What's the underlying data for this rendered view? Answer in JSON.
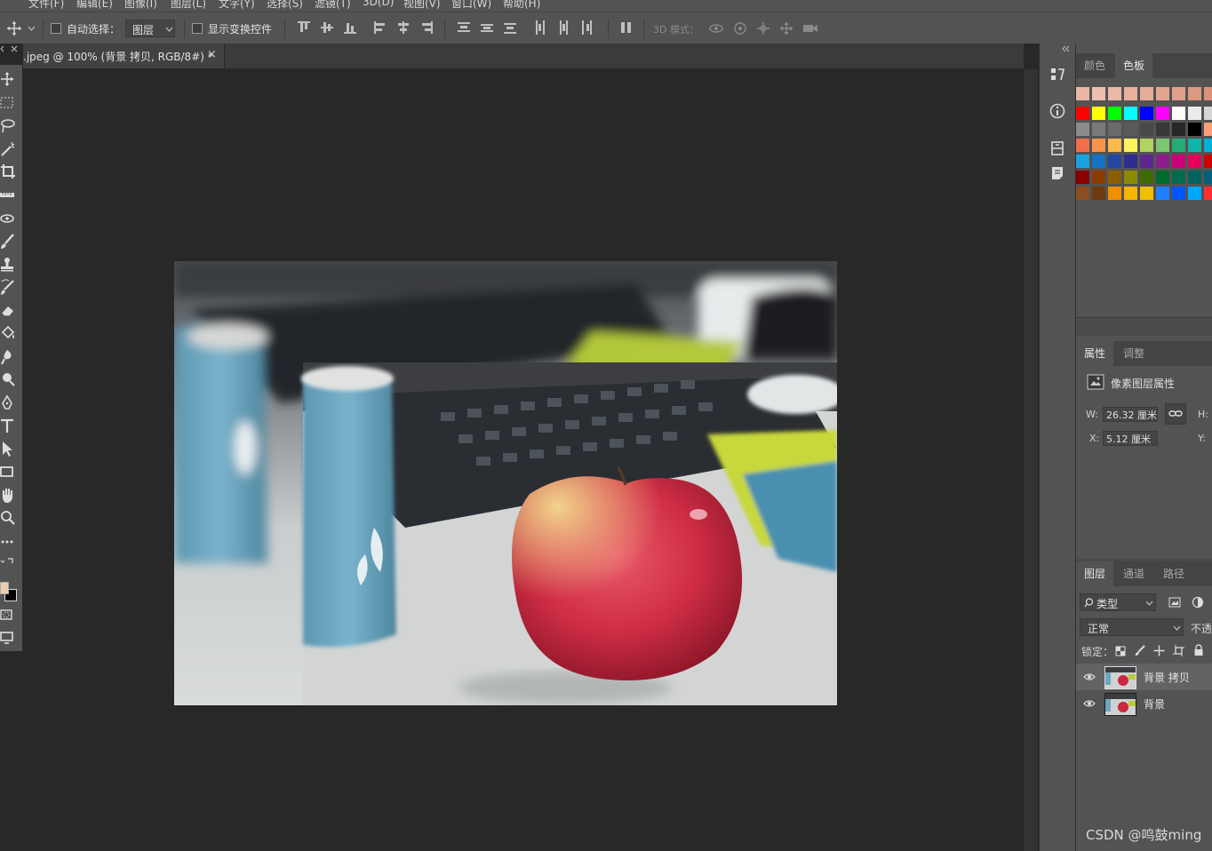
{
  "menubar": {
    "items": [
      "文件(F)",
      "编辑(E)",
      "图像(I)",
      "图层(L)",
      "文字(Y)",
      "选择(S)",
      "滤镜(T)",
      "3D(D)",
      "视图(V)",
      "窗口(W)",
      "帮助(H)"
    ]
  },
  "options": {
    "auto_select_label": "自动选择：",
    "auto_select_value": "图层",
    "show_transform_label": "显示变换控件",
    "mode_3d_label": "3D 模式："
  },
  "document": {
    "tab_title": ".jpeg @ 100% (背景 拷贝, RGB/8#) *",
    "close_glyph": "×"
  },
  "swatches_panel": {
    "tabs": [
      "颜色",
      "色板"
    ],
    "active_tab": "色板",
    "rows": [
      [
        "#e9b7a6",
        "#ecc0b1",
        "#eab9a8",
        "#e8b29f",
        "#e6ad98",
        "#e4a691",
        "#e0a08a",
        "#dd9882",
        "#da927c",
        "#d88c75"
      ],
      [
        "#ff0000",
        "#ffff00",
        "#00ff00",
        "#00ffff",
        "#0000ff",
        "#ff00ff",
        "#ffffff",
        "#ebebeb",
        "#d6d6d6",
        "#ff8080"
      ],
      [
        "#8c8c8c",
        "#7a7a7a",
        "#6a6a6a",
        "#5a5a5a",
        "#494949",
        "#383838",
        "#272727",
        "#000000",
        "#ff9e7a",
        "#ffa07a"
      ],
      [
        "#f26d4c",
        "#f7944a",
        "#fdb94e",
        "#fff45c",
        "#b2d35d",
        "#7dc670",
        "#26ad74",
        "#0fb5a8",
        "#00b2d8",
        "#ff5a5a"
      ],
      [
        "#1aa3e0",
        "#1473c4",
        "#2346a3",
        "#2e2c8f",
        "#5f2590",
        "#8d1d8d",
        "#cc007a",
        "#e6005c",
        "#d10000",
        "#9e0039"
      ],
      [
        "#8c0000",
        "#8a3b00",
        "#8c5e00",
        "#8c8a00",
        "#3d6b00",
        "#006b2e",
        "#006b4d",
        "#00635f",
        "#005f7a",
        "#1c4280"
      ],
      [
        "#8b4e22",
        "#6e3b10",
        "#f18f00",
        "#f7b500",
        "#f2bf00",
        "#1f7fff",
        "#0055ff",
        "#00a7ff",
        "#ff3030",
        "#ff5050"
      ]
    ]
  },
  "properties_panel": {
    "tabs": [
      "属性",
      "调整"
    ],
    "active_tab": "属性",
    "section_title": "像素图层属性",
    "w_label": "W:",
    "w_value": "26.32 厘米",
    "h_label": "H:",
    "x_label": "X:",
    "x_value": "5.12 厘米",
    "y_label": "Y:"
  },
  "layers_panel": {
    "tabs": [
      "图层",
      "通道",
      "路径"
    ],
    "active_tab": "图层",
    "filter_label": "类型",
    "blend_mode": "正常",
    "opacity_label": "不透",
    "lock_label": "锁定：",
    "layers": [
      {
        "name": "背景 拷贝",
        "selected": true
      },
      {
        "name": "背景",
        "selected": false
      }
    ]
  },
  "watermark": "CSDN @鸣鼓ming",
  "colors": {
    "foreground": "#e8cdb3",
    "background": "#000000"
  }
}
